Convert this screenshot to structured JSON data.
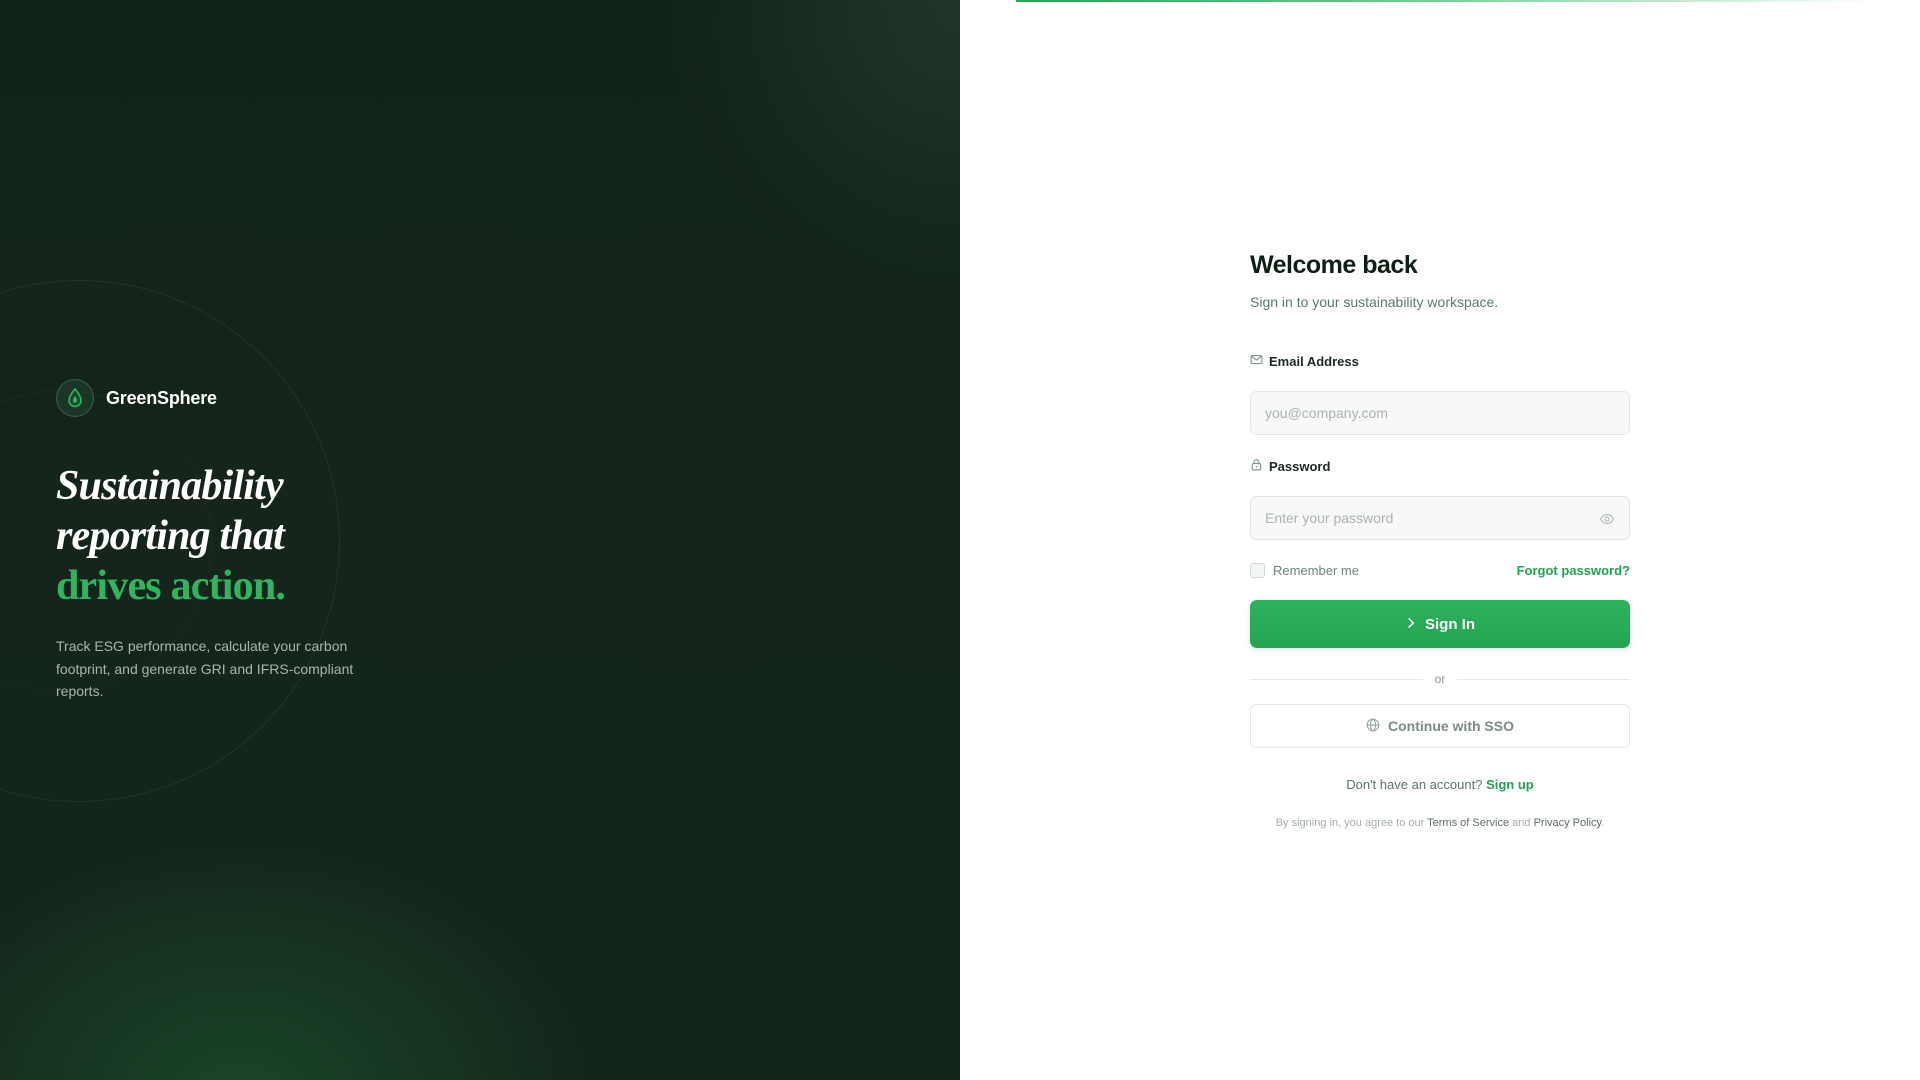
{
  "brand": {
    "name": "GreenSphere",
    "logo_icon": "leaf-drop-icon",
    "headline_line1": "Sustainability",
    "headline_line2": "reporting that",
    "headline_accent": "drives action.",
    "description": "Track ESG performance, calculate your carbon footprint, and generate GRI and IFRS-compliant reports."
  },
  "form": {
    "title": "Welcome back",
    "subtitle": "Sign in to your sustainability workspace.",
    "email": {
      "label": "Email Address",
      "icon": "mail-icon",
      "value": "",
      "placeholder": "you@company.com"
    },
    "password": {
      "label": "Password",
      "icon": "lock-icon",
      "value": "",
      "placeholder": "Enter your password",
      "toggle_icon": "eye-icon"
    },
    "remember_label": "Remember me",
    "remember_checked": false,
    "forgot_label": "Forgot password?",
    "signin_label": "Sign In",
    "signin_icon": "chevron-right-icon",
    "divider_label": "or",
    "sso_label": "Continue with SSO",
    "sso_icon": "globe-icon",
    "signup_prompt": "Don't have an account?",
    "signup_link": "Sign up",
    "terms_prefix": "By signing in, you agree to our",
    "terms_link": "Terms of Service",
    "terms_and": "and",
    "privacy_link": "Privacy Policy",
    "terms_suffix": "."
  },
  "colors": {
    "brand_bg": "#13251a",
    "accent_green": "#24a552",
    "headline_accent": "#2fb560",
    "form_bg": "#ffffff"
  }
}
